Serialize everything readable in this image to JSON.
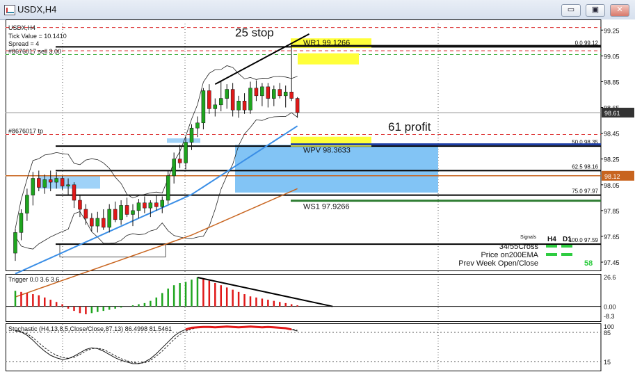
{
  "window": {
    "title": "USDX,H4",
    "minimize_glyph": "▭",
    "restore_glyph": "▣",
    "close_glyph": "✕"
  },
  "chart_data": {
    "type": "candlestick",
    "symbol_label": "USDX,H4",
    "info_lines": [
      "Tick Value = 10.1410",
      "Spread = 4",
      "#8676017 sell 3.00"
    ],
    "tp_label": "#8676017 tp",
    "price_axis": {
      "min": 97.38,
      "max": 99.3,
      "ticks": [
        99.25,
        99.05,
        98.85,
        98.65,
        98.45,
        98.25,
        98.05,
        97.85,
        97.65,
        97.45
      ],
      "current_price": 98.61,
      "current_price_color": "#333333",
      "ema_price": 98.12,
      "ema_price_color": "#c8641e"
    },
    "candles": [
      {
        "o": 97.52,
        "h": 97.71,
        "l": 97.46,
        "c": 97.68
      },
      {
        "o": 97.68,
        "h": 97.86,
        "l": 97.62,
        "c": 97.83
      },
      {
        "o": 97.83,
        "h": 98.02,
        "l": 97.77,
        "c": 97.97
      },
      {
        "o": 97.97,
        "h": 98.15,
        "l": 97.89,
        "c": 98.1
      },
      {
        "o": 98.1,
        "h": 98.16,
        "l": 98.0,
        "c": 98.03
      },
      {
        "o": 98.03,
        "h": 98.13,
        "l": 97.98,
        "c": 98.09
      },
      {
        "o": 98.09,
        "h": 98.16,
        "l": 98.0,
        "c": 98.07
      },
      {
        "o": 98.07,
        "h": 98.15,
        "l": 98.02,
        "c": 98.1
      },
      {
        "o": 98.1,
        "h": 98.12,
        "l": 98.01,
        "c": 98.04
      },
      {
        "o": 98.04,
        "h": 98.1,
        "l": 97.97,
        "c": 98.05
      },
      {
        "o": 98.05,
        "h": 98.07,
        "l": 97.87,
        "c": 97.93
      },
      {
        "o": 97.93,
        "h": 97.97,
        "l": 97.8,
        "c": 97.86
      },
      {
        "o": 97.86,
        "h": 97.9,
        "l": 97.74,
        "c": 97.79
      },
      {
        "o": 97.79,
        "h": 97.83,
        "l": 97.69,
        "c": 97.73
      },
      {
        "o": 97.73,
        "h": 97.84,
        "l": 97.68,
        "c": 97.79
      },
      {
        "o": 97.79,
        "h": 97.86,
        "l": 97.7,
        "c": 97.72
      },
      {
        "o": 97.72,
        "h": 97.9,
        "l": 97.68,
        "c": 97.86
      },
      {
        "o": 97.86,
        "h": 97.92,
        "l": 97.76,
        "c": 97.78
      },
      {
        "o": 97.78,
        "h": 97.93,
        "l": 97.74,
        "c": 97.89
      },
      {
        "o": 97.89,
        "h": 97.95,
        "l": 97.8,
        "c": 97.82
      },
      {
        "o": 97.82,
        "h": 97.9,
        "l": 97.73,
        "c": 97.85
      },
      {
        "o": 97.85,
        "h": 97.94,
        "l": 97.79,
        "c": 97.91
      },
      {
        "o": 97.91,
        "h": 97.96,
        "l": 97.83,
        "c": 97.87
      },
      {
        "o": 97.87,
        "h": 97.93,
        "l": 97.8,
        "c": 97.91
      },
      {
        "o": 97.91,
        "h": 97.97,
        "l": 97.85,
        "c": 97.88
      },
      {
        "o": 97.88,
        "h": 97.96,
        "l": 97.83,
        "c": 97.93
      },
      {
        "o": 97.93,
        "h": 98.16,
        "l": 97.9,
        "c": 98.12
      },
      {
        "o": 98.12,
        "h": 98.3,
        "l": 98.06,
        "c": 98.25
      },
      {
        "o": 98.25,
        "h": 98.36,
        "l": 98.18,
        "c": 98.22
      },
      {
        "o": 98.22,
        "h": 98.42,
        "l": 98.17,
        "c": 98.38
      },
      {
        "o": 98.38,
        "h": 98.52,
        "l": 98.32,
        "c": 98.49
      },
      {
        "o": 98.49,
        "h": 98.58,
        "l": 98.42,
        "c": 98.53
      },
      {
        "o": 98.53,
        "h": 98.8,
        "l": 98.48,
        "c": 98.78
      },
      {
        "o": 98.78,
        "h": 98.83,
        "l": 98.6,
        "c": 98.64
      },
      {
        "o": 98.64,
        "h": 98.72,
        "l": 98.58,
        "c": 98.67
      },
      {
        "o": 98.67,
        "h": 98.85,
        "l": 98.62,
        "c": 98.72
      },
      {
        "o": 98.72,
        "h": 98.83,
        "l": 98.64,
        "c": 98.79
      },
      {
        "o": 98.79,
        "h": 98.84,
        "l": 98.58,
        "c": 98.63
      },
      {
        "o": 98.63,
        "h": 98.74,
        "l": 98.57,
        "c": 98.7
      },
      {
        "o": 98.7,
        "h": 98.76,
        "l": 98.6,
        "c": 98.63
      },
      {
        "o": 98.63,
        "h": 98.85,
        "l": 98.6,
        "c": 98.8
      },
      {
        "o": 98.8,
        "h": 98.86,
        "l": 98.7,
        "c": 98.74
      },
      {
        "o": 98.74,
        "h": 98.84,
        "l": 98.66,
        "c": 98.81
      },
      {
        "o": 98.81,
        "h": 98.84,
        "l": 98.65,
        "c": 98.72
      },
      {
        "o": 98.72,
        "h": 98.82,
        "l": 98.66,
        "c": 98.79
      },
      {
        "o": 98.79,
        "h": 98.84,
        "l": 98.72,
        "c": 98.74
      },
      {
        "o": 98.74,
        "h": 98.82,
        "l": 98.65,
        "c": 98.77
      },
      {
        "o": 98.77,
        "h": 99.12,
        "l": 98.7,
        "c": 98.72
      },
      {
        "o": 98.72,
        "h": 98.73,
        "l": 98.57,
        "c": 98.61
      }
    ],
    "pivot_levels": [
      {
        "label": "WR1",
        "value": "99.1266",
        "price": 99.1266,
        "color": "#111111",
        "highlight": true
      },
      {
        "label": "WPV",
        "value": "98.3633",
        "price": 98.3633,
        "color": "#1f3fa6",
        "highlight": true
      },
      {
        "label": "WS1",
        "value": "97.9266",
        "price": 97.9266,
        "color": "#2e7d32",
        "highlight": false
      }
    ],
    "fib_levels": [
      {
        "label": "0.0",
        "price": 99.12,
        "price_text": "99.12"
      },
      {
        "label": "50.0",
        "price": 98.35,
        "price_text": "98.35"
      },
      {
        "label": "62.5",
        "price": 98.16,
        "price_text": "98.16"
      },
      {
        "label": "75.0",
        "price": 97.97,
        "price_text": "97.97"
      },
      {
        "label": "100.0",
        "price": 97.59,
        "price_text": "97.59"
      }
    ],
    "annotations": [
      {
        "text": "25 stop",
        "price": 99.2
      },
      {
        "text": "61 profit",
        "price": 98.47
      }
    ],
    "signals_panel": {
      "title": "Signals",
      "col_h4": "H4",
      "col_d1": "D1",
      "rows": [
        "34/55Cross",
        "Price on200EMA",
        "Prev Week Open/Close"
      ],
      "prev_week_value": "58",
      "signal_color": "#2ecc40"
    },
    "trigger": {
      "label": "Trigger 0.0 3.6 3.6",
      "ticks": [
        "26.6",
        "0.00",
        "-8.3"
      ],
      "min": -8.3,
      "max": 26.6,
      "values": [
        14,
        13,
        12,
        11,
        10,
        8,
        6,
        4,
        2,
        -2,
        -4,
        -6,
        -7,
        -6,
        -5,
        -4,
        -3,
        -2,
        -1,
        0,
        1,
        2,
        3,
        5,
        8,
        12,
        16,
        19,
        21,
        22,
        24,
        26,
        25,
        23,
        21,
        19,
        17,
        15,
        13,
        11,
        9,
        8,
        7,
        6,
        5,
        4,
        3,
        2,
        1
      ]
    },
    "stochastic": {
      "label": "Stochastic (H4,13,8,5,Close/Close,87.13) 86.4998 81.5461",
      "ticks": [
        "100",
        "85",
        "15"
      ],
      "min": 0,
      "max": 100,
      "main": [
        90,
        86,
        78,
        66,
        52,
        40,
        30,
        24,
        20,
        22,
        28,
        36,
        44,
        48,
        46,
        40,
        32,
        24,
        18,
        14,
        10,
        10,
        14,
        22,
        34,
        48,
        62,
        76,
        86,
        92,
        96,
        97,
        98,
        98,
        97,
        98,
        99,
        98,
        97,
        98,
        99,
        98,
        97,
        98,
        97,
        96,
        95,
        92,
        88
      ],
      "signal": [
        88,
        87,
        82,
        72,
        60,
        48,
        38,
        30,
        25,
        23,
        25,
        32,
        40,
        46,
        47,
        44,
        37,
        29,
        22,
        17,
        13,
        11,
        12,
        18,
        28,
        40,
        54,
        68,
        80,
        88,
        93,
        96,
        97,
        98,
        98,
        97,
        98,
        98,
        98,
        97,
        98,
        98,
        98,
        97,
        97,
        96,
        95,
        93,
        90
      ]
    }
  }
}
